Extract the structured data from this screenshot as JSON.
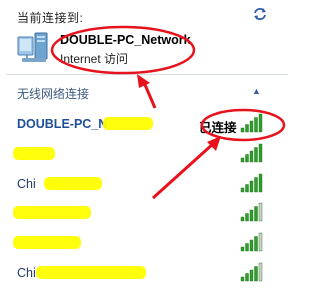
{
  "header": {
    "label": "当前连接到:",
    "refresh_icon": "refresh-icon"
  },
  "current_connection": {
    "icon": "computer-network-icon",
    "name": "DOUBLE-PC_Network",
    "status": "Internet 访问"
  },
  "wireless_section": {
    "title": "无线网络连接",
    "collapse_icon": "chevron-up-icon"
  },
  "networks": [
    {
      "name": "DOUBLE-PC_N",
      "status": "已连接",
      "signal_bars": 5,
      "selected": true
    },
    {
      "name": "",
      "status": "",
      "signal_bars": 5,
      "selected": false
    },
    {
      "name": "Chi",
      "status": "",
      "signal_bars": 5,
      "selected": false
    },
    {
      "name": "",
      "status": "",
      "signal_bars": 4,
      "selected": false
    },
    {
      "name": "",
      "status": "",
      "signal_bars": 4,
      "selected": false
    },
    {
      "name": "Chi",
      "status": "",
      "signal_bars": 4,
      "selected": false
    }
  ],
  "colors": {
    "annotation_red": "#e8121c",
    "redaction_yellow": "#ffff00",
    "signal_green": "#2e9d2b"
  }
}
